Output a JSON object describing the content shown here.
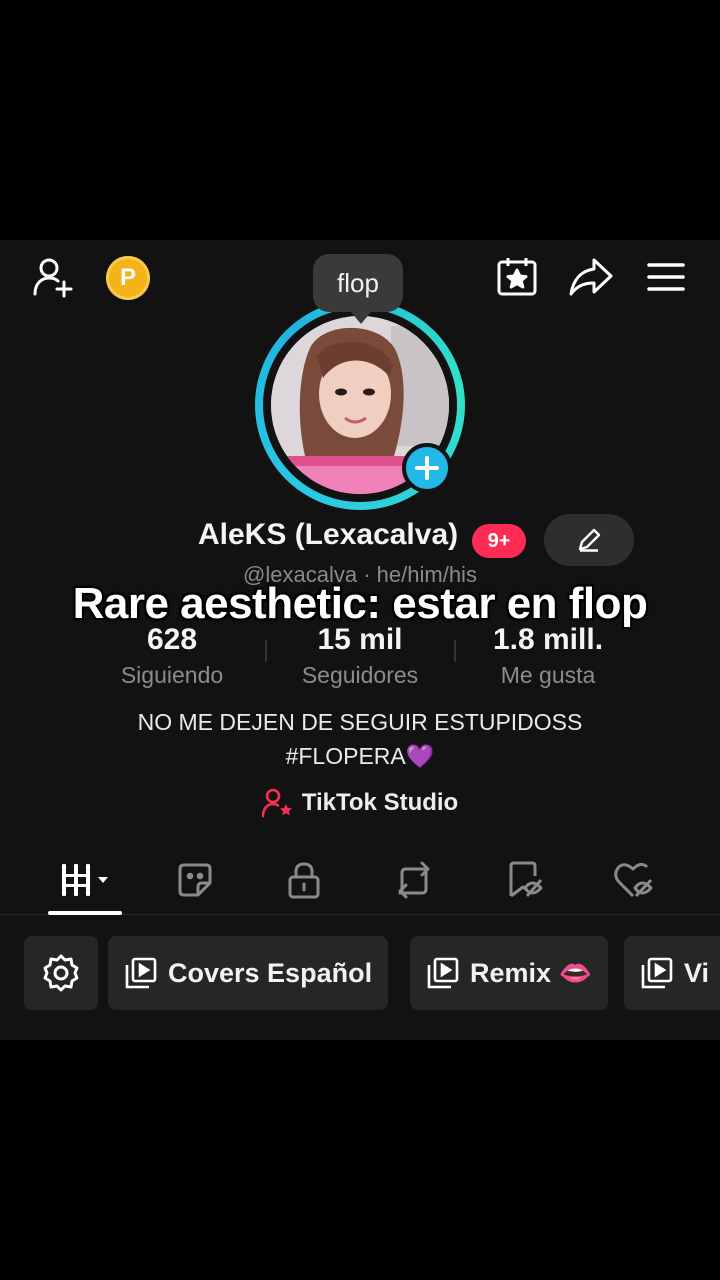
{
  "header": {
    "coin_label": "P",
    "tooltip": "flop"
  },
  "profile": {
    "display_name": "AleKS (Lexacalva)",
    "notification_badge": "9+",
    "handle": "@lexacalva",
    "separator": "·",
    "pronouns": "he/him/his",
    "stats": [
      {
        "value": "628",
        "label": "Siguiendo"
      },
      {
        "value": "15 mil",
        "label": "Seguidores"
      },
      {
        "value": "1.8 mill.",
        "label": "Me gusta"
      }
    ],
    "bio_line1": "NO ME DEJEN DE SEGUIR ESTUPIDOSS",
    "bio_line2": "#FLOPERA💜",
    "studio_label": "TikTok Studio"
  },
  "overlay": {
    "caption": "Rare aesthetic: estar en flop"
  },
  "playlists": [
    {
      "label": "Covers Español"
    },
    {
      "label": "Remix 👄"
    },
    {
      "label": "Vi"
    }
  ],
  "colors": {
    "accent_pink": "#fe2c55",
    "ring_cyan": "#2cc9e4",
    "coin_gold": "#f4b21b",
    "background": "#121212"
  }
}
